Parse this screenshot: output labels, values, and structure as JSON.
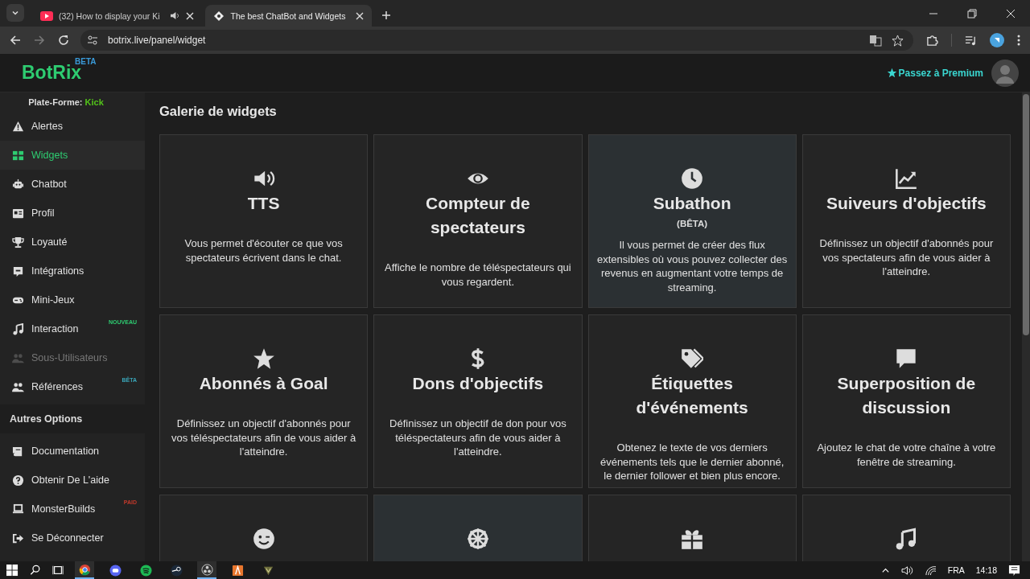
{
  "browser": {
    "tabs": [
      {
        "title": "(32) How to display your Ki",
        "selected": false,
        "audio": true
      },
      {
        "title": "The best ChatBot and Widgets",
        "selected": true,
        "audio": false
      }
    ],
    "url": "botrix.live/panel/widget"
  },
  "header": {
    "logo": "BotRix",
    "logo_badge": "BETA",
    "premium": "Passez à Premium"
  },
  "sidebar": {
    "platform_label": "Plate-Forme:",
    "platform": "Kick",
    "items": [
      {
        "label": "Alertes",
        "selected": false,
        "disabled": false
      },
      {
        "label": "Widgets",
        "selected": true,
        "disabled": false
      },
      {
        "label": "Chatbot",
        "selected": false,
        "disabled": false
      },
      {
        "label": "Profil",
        "selected": false,
        "disabled": false
      },
      {
        "label": "Loyauté",
        "selected": false,
        "disabled": false
      },
      {
        "label": "Intégrations",
        "selected": false,
        "disabled": false
      },
      {
        "label": "Mini-Jeux",
        "selected": false,
        "disabled": false
      },
      {
        "label": "Interaction",
        "selected": false,
        "disabled": false,
        "badge": "NOUVEAU",
        "color": "#2ecc71"
      },
      {
        "label": "Sous-Utilisateurs",
        "selected": false,
        "disabled": true
      },
      {
        "label": "Références",
        "selected": false,
        "disabled": false,
        "badge": "BÊTA",
        "color": "#3aa6b9"
      }
    ],
    "section": "Autres Options",
    "other_items": [
      {
        "label": "Documentation",
        "selected": false
      },
      {
        "label": "Obtenir De L'aide",
        "selected": false
      },
      {
        "label": "MonsterBuilds",
        "selected": false,
        "badge": "PAID",
        "color": "#c0392b"
      },
      {
        "label": "Se Déconnecter",
        "selected": false
      }
    ]
  },
  "main": {
    "title": "Galerie de widgets",
    "cards": [
      {
        "title": "TTS",
        "description": "Vous permet d'écouter ce que vos spectateurs écrivent dans le chat.",
        "highlighted": false
      },
      {
        "title": "Compteur de spectateurs",
        "description": "Affiche le nombre de téléspectateurs qui vous regardent.",
        "highlighted": false
      },
      {
        "title": "Subathon",
        "subtitle": "(BÊTA)",
        "description": "Il vous permet de créer des flux extensibles où vous pouvez collecter des revenus en augmentant votre temps de streaming.",
        "highlighted": true
      },
      {
        "title": "Suiveurs d'objectifs",
        "description": "Définissez un objectif d'abonnés pour vos spectateurs afin de vous aider à l'atteindre.",
        "highlighted": false
      },
      {
        "title": "Abonnés à Goal",
        "description": "Définissez un objectif d'abonnés pour vos téléspectateurs afin de vous aider à l'atteindre.",
        "highlighted": false
      },
      {
        "title": "Dons d'objectifs",
        "description": "Définissez un objectif de don pour vos téléspectateurs afin de vous aider à l'atteindre.",
        "highlighted": false
      },
      {
        "title": "Étiquettes d'événements",
        "description": "Obtenez le texte de vos derniers événements tels que le dernier abonné, le dernier follower et bien plus encore.",
        "highlighted": false
      },
      {
        "title": "Superposition de discussion",
        "description": "Ajoutez le chat de votre chaîne à votre fenêtre de streaming.",
        "highlighted": false
      },
      {
        "highlighted": false
      },
      {
        "highlighted": true
      },
      {
        "highlighted": false
      },
      {
        "highlighted": false
      }
    ]
  },
  "taskbar": {
    "apps": [
      {
        "selected": true
      },
      {
        "selected": false
      },
      {
        "selected": false
      },
      {
        "selected": false
      },
      {
        "selected": true
      },
      {
        "selected": false
      },
      {
        "selected": false
      }
    ],
    "language": "FRA",
    "time": "14:18"
  }
}
